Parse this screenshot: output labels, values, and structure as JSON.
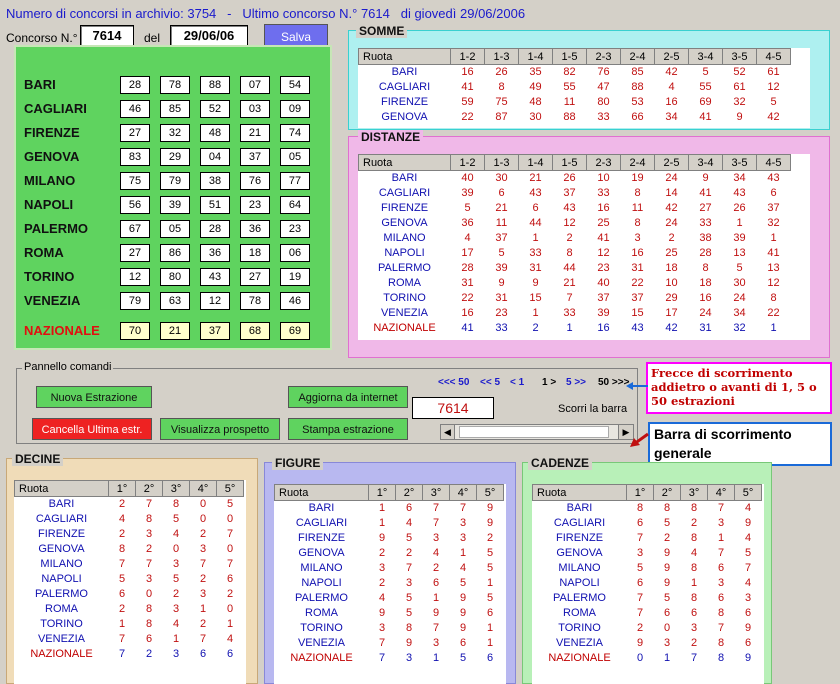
{
  "header": {
    "archive_label": "Numero di concorsi in archivio:",
    "archive_count": "3754",
    "sep": "-",
    "last_label": "Ultimo concorso N.°",
    "last_num": "7614",
    "day_label": "di giovedì",
    "last_date": "29/06/2006"
  },
  "form": {
    "concorso_label": "Concorso N.°",
    "concorso_value": "7614",
    "del_label": "del",
    "date_value": "29/06/06",
    "save_label": "Salva"
  },
  "estrazione": [
    {
      "ruota": "BARI",
      "nums": [
        "28",
        "78",
        "88",
        "07",
        "54"
      ]
    },
    {
      "ruota": "CAGLIARI",
      "nums": [
        "46",
        "85",
        "52",
        "03",
        "09"
      ]
    },
    {
      "ruota": "FIRENZE",
      "nums": [
        "27",
        "32",
        "48",
        "21",
        "74"
      ]
    },
    {
      "ruota": "GENOVA",
      "nums": [
        "83",
        "29",
        "04",
        "37",
        "05"
      ]
    },
    {
      "ruota": "MILANO",
      "nums": [
        "75",
        "79",
        "38",
        "76",
        "77"
      ]
    },
    {
      "ruota": "NAPOLI",
      "nums": [
        "56",
        "39",
        "51",
        "23",
        "64"
      ]
    },
    {
      "ruota": "PALERMO",
      "nums": [
        "67",
        "05",
        "28",
        "36",
        "23"
      ]
    },
    {
      "ruota": "ROMA",
      "nums": [
        "27",
        "86",
        "36",
        "18",
        "06"
      ]
    },
    {
      "ruota": "TORINO",
      "nums": [
        "12",
        "80",
        "43",
        "27",
        "19"
      ]
    },
    {
      "ruota": "VENEZIA",
      "nums": [
        "79",
        "63",
        "12",
        "78",
        "46"
      ]
    }
  ],
  "nazionale": {
    "ruota": "NAZIONALE",
    "nums": [
      "70",
      "21",
      "37",
      "68",
      "69"
    ]
  },
  "somme": {
    "title": "SOMME",
    "headers": [
      "Ruota",
      "1-2",
      "1-3",
      "1-4",
      "1-5",
      "2-3",
      "2-4",
      "2-5",
      "3-4",
      "3-5",
      "4-5"
    ],
    "rows": [
      [
        "BARI",
        "16",
        "26",
        "35",
        "82",
        "76",
        "85",
        "42",
        "5",
        "52",
        "61"
      ],
      [
        "CAGLIARI",
        "41",
        "8",
        "49",
        "55",
        "47",
        "88",
        "4",
        "55",
        "61",
        "12"
      ],
      [
        "FIRENZE",
        "59",
        "75",
        "48",
        "11",
        "80",
        "53",
        "16",
        "69",
        "32",
        "5"
      ],
      [
        "GENOVA",
        "22",
        "87",
        "30",
        "88",
        "33",
        "66",
        "34",
        "41",
        "9",
        "42"
      ]
    ]
  },
  "distanze": {
    "title": "DISTANZE",
    "headers": [
      "Ruota",
      "1-2",
      "1-3",
      "1-4",
      "1-5",
      "2-3",
      "2-4",
      "2-5",
      "3-4",
      "3-5",
      "4-5"
    ],
    "rows": [
      [
        "BARI",
        "40",
        "30",
        "21",
        "26",
        "10",
        "19",
        "24",
        "9",
        "34",
        "43"
      ],
      [
        "CAGLIARI",
        "39",
        "6",
        "43",
        "37",
        "33",
        "8",
        "14",
        "41",
        "43",
        "6"
      ],
      [
        "FIRENZE",
        "5",
        "21",
        "6",
        "43",
        "16",
        "11",
        "42",
        "27",
        "26",
        "37"
      ],
      [
        "GENOVA",
        "36",
        "11",
        "44",
        "12",
        "25",
        "8",
        "24",
        "33",
        "1",
        "32"
      ],
      [
        "MILANO",
        "4",
        "37",
        "1",
        "2",
        "41",
        "3",
        "2",
        "38",
        "39",
        "1"
      ],
      [
        "NAPOLI",
        "17",
        "5",
        "33",
        "8",
        "12",
        "16",
        "25",
        "28",
        "13",
        "41"
      ],
      [
        "PALERMO",
        "28",
        "39",
        "31",
        "44",
        "23",
        "31",
        "18",
        "8",
        "5",
        "13"
      ],
      [
        "ROMA",
        "31",
        "9",
        "9",
        "21",
        "40",
        "22",
        "10",
        "18",
        "30",
        "12"
      ],
      [
        "TORINO",
        "22",
        "31",
        "15",
        "7",
        "37",
        "37",
        "29",
        "16",
        "24",
        "8"
      ],
      [
        "VENEZIA",
        "16",
        "23",
        "1",
        "33",
        "39",
        "15",
        "17",
        "24",
        "34",
        "22"
      ],
      [
        "NAZIONALE",
        "41",
        "33",
        "2",
        "1",
        "16",
        "43",
        "42",
        "31",
        "32",
        "1"
      ]
    ]
  },
  "comandi": {
    "title": "Pannello comandi",
    "nuova": "Nuova Estrazione",
    "aggiorna": "Aggiorna da internet",
    "cancella": "Cancella Ultima estr.",
    "visualizza": "Visualizza prospetto",
    "stampa": "Stampa estrazione",
    "nav": [
      "<<< 50",
      "<< 5",
      "< 1",
      "1 >",
      "5 >>",
      "50 >>>"
    ],
    "current": "7614",
    "scorri": "Scorri la barra"
  },
  "annotations": {
    "frecce": "Frecce di scorrimento addietro o avanti di 1, 5 o 50 estrazioni",
    "barra": "Barra di scorrimento generale"
  },
  "decine": {
    "title": "DECINE",
    "headers": [
      "Ruota",
      "1°",
      "2°",
      "3°",
      "4°",
      "5°"
    ],
    "rows": [
      [
        "BARI",
        "2",
        "7",
        "8",
        "0",
        "5"
      ],
      [
        "CAGLIARI",
        "4",
        "8",
        "5",
        "0",
        "0"
      ],
      [
        "FIRENZE",
        "2",
        "3",
        "4",
        "2",
        "7"
      ],
      [
        "GENOVA",
        "8",
        "2",
        "0",
        "3",
        "0"
      ],
      [
        "MILANO",
        "7",
        "7",
        "3",
        "7",
        "7"
      ],
      [
        "NAPOLI",
        "5",
        "3",
        "5",
        "2",
        "6"
      ],
      [
        "PALERMO",
        "6",
        "0",
        "2",
        "3",
        "2"
      ],
      [
        "ROMA",
        "2",
        "8",
        "3",
        "1",
        "0"
      ],
      [
        "TORINO",
        "1",
        "8",
        "4",
        "2",
        "1"
      ],
      [
        "VENEZIA",
        "7",
        "6",
        "1",
        "7",
        "4"
      ],
      [
        "NAZIONALE",
        "7",
        "2",
        "3",
        "6",
        "6"
      ]
    ]
  },
  "figure": {
    "title": "FIGURE",
    "headers": [
      "Ruota",
      "1°",
      "2°",
      "3°",
      "4°",
      "5°"
    ],
    "rows": [
      [
        "BARI",
        "1",
        "6",
        "7",
        "7",
        "9"
      ],
      [
        "CAGLIARI",
        "1",
        "4",
        "7",
        "3",
        "9"
      ],
      [
        "FIRENZE",
        "9",
        "5",
        "3",
        "3",
        "2"
      ],
      [
        "GENOVA",
        "2",
        "2",
        "4",
        "1",
        "5"
      ],
      [
        "MILANO",
        "3",
        "7",
        "2",
        "4",
        "5"
      ],
      [
        "NAPOLI",
        "2",
        "3",
        "6",
        "5",
        "1"
      ],
      [
        "PALERMO",
        "4",
        "5",
        "1",
        "9",
        "5"
      ],
      [
        "ROMA",
        "9",
        "5",
        "9",
        "9",
        "6"
      ],
      [
        "TORINO",
        "3",
        "8",
        "7",
        "9",
        "1"
      ],
      [
        "VENEZIA",
        "7",
        "9",
        "3",
        "6",
        "1"
      ],
      [
        "NAZIONALE",
        "7",
        "3",
        "1",
        "5",
        "6"
      ]
    ]
  },
  "cadenze": {
    "title": "CADENZE",
    "headers": [
      "Ruota",
      "1°",
      "2°",
      "3°",
      "4°",
      "5°"
    ],
    "rows": [
      [
        "BARI",
        "8",
        "8",
        "8",
        "7",
        "4"
      ],
      [
        "CAGLIARI",
        "6",
        "5",
        "2",
        "3",
        "9"
      ],
      [
        "FIRENZE",
        "7",
        "2",
        "8",
        "1",
        "4"
      ],
      [
        "GENOVA",
        "3",
        "9",
        "4",
        "7",
        "5"
      ],
      [
        "MILANO",
        "5",
        "9",
        "8",
        "6",
        "7"
      ],
      [
        "NAPOLI",
        "6",
        "9",
        "1",
        "3",
        "4"
      ],
      [
        "PALERMO",
        "7",
        "5",
        "8",
        "6",
        "3"
      ],
      [
        "ROMA",
        "7",
        "6",
        "6",
        "8",
        "6"
      ],
      [
        "TORINO",
        "2",
        "0",
        "3",
        "7",
        "9"
      ],
      [
        "VENEZIA",
        "9",
        "3",
        "2",
        "8",
        "6"
      ],
      [
        "NAZIONALE",
        "0",
        "1",
        "7",
        "8",
        "9"
      ]
    ]
  },
  "colors": {
    "green": "#5fd35f",
    "cyan_panel": "#aef0f0",
    "pink_panel": "#f0b8e8",
    "violet_panel": "#b8b8f0",
    "beige_panel": "#f0dcb8",
    "light_green_panel": "#b8f0b8",
    "blue_text": "#1a1acc",
    "red_text": "#c01010",
    "magenta": "#ff00ff"
  }
}
